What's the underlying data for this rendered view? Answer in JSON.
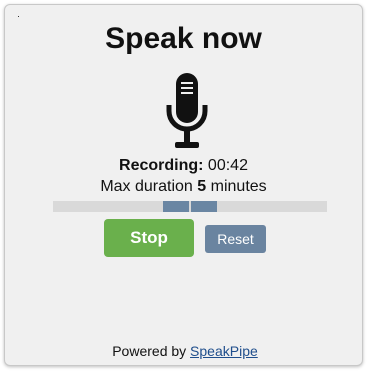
{
  "widget": {
    "title": "Speak now",
    "recording_label": "Recording:",
    "recording_time": "00:42",
    "max_duration_prefix": "Max duration",
    "max_duration_value": "5",
    "max_duration_suffix": "minutes",
    "mic_icon": "microphone-icon",
    "level_meter": {
      "segments_active": 2,
      "color_active": "#6a86a3",
      "color_track": "#d9d9d9"
    }
  },
  "buttons": {
    "stop_label": "Stop",
    "reset_label": "Reset",
    "stop_color": "#6ab04c",
    "reset_color": "#6a84a0"
  },
  "footer": {
    "prefix": "Powered by",
    "link_text": "SpeakPipe"
  }
}
